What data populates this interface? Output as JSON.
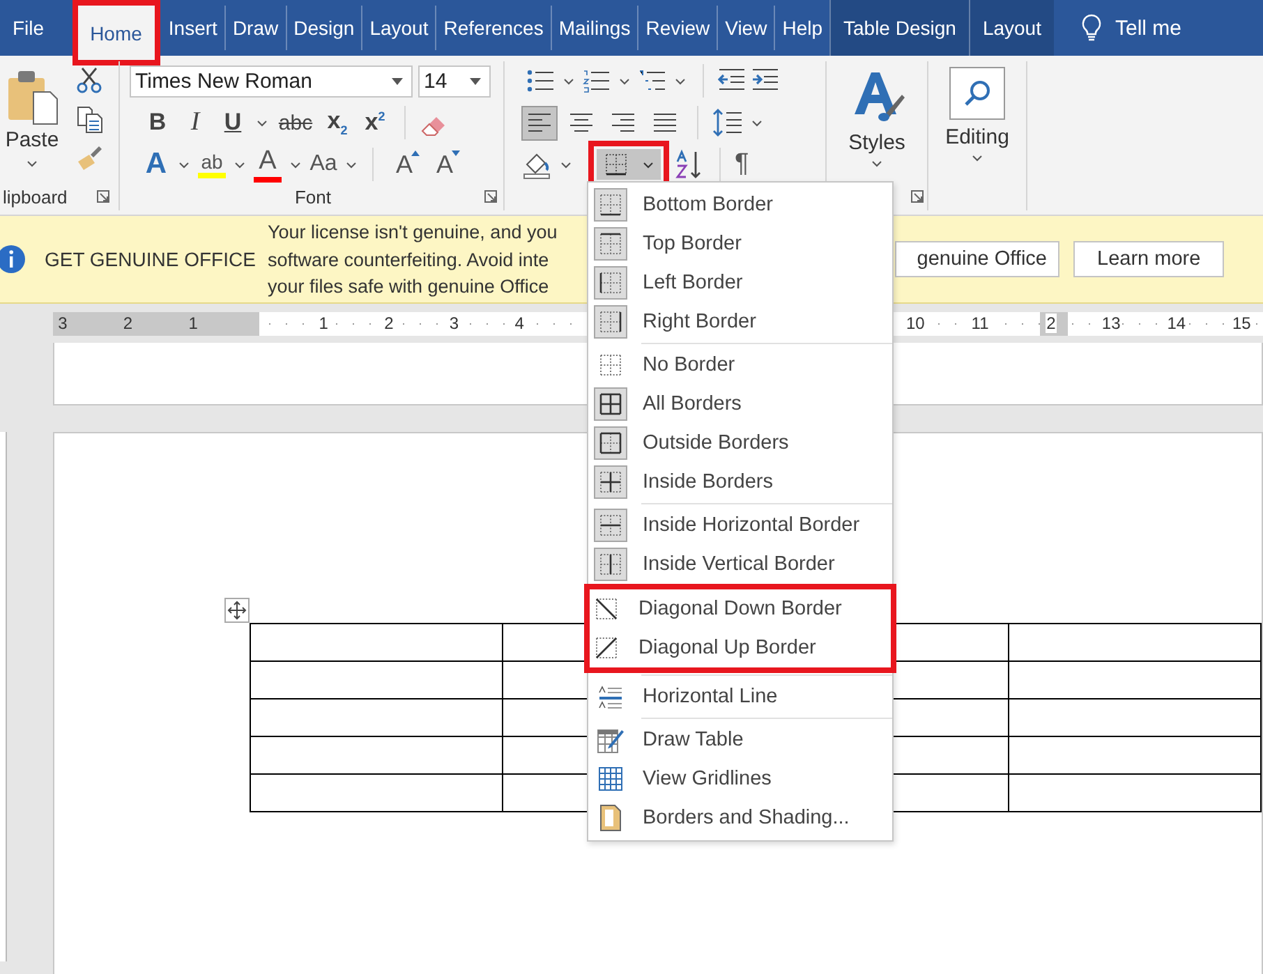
{
  "tabs": [
    {
      "label": "File",
      "selected": false,
      "contextual": false,
      "highlighted": false
    },
    {
      "label": "Home",
      "selected": true,
      "contextual": false,
      "highlighted": true
    },
    {
      "label": "Insert",
      "selected": false,
      "contextual": false,
      "highlighted": false
    },
    {
      "label": "Draw",
      "selected": false,
      "contextual": false,
      "highlighted": false
    },
    {
      "label": "Design",
      "selected": false,
      "contextual": false,
      "highlighted": false
    },
    {
      "label": "Layout",
      "selected": false,
      "contextual": false,
      "highlighted": false
    },
    {
      "label": "References",
      "selected": false,
      "contextual": false,
      "highlighted": false
    },
    {
      "label": "Mailings",
      "selected": false,
      "contextual": false,
      "highlighted": false
    },
    {
      "label": "Review",
      "selected": false,
      "contextual": false,
      "highlighted": false
    },
    {
      "label": "View",
      "selected": false,
      "contextual": false,
      "highlighted": false
    },
    {
      "label": "Help",
      "selected": false,
      "contextual": false,
      "highlighted": false
    },
    {
      "label": "Table Design",
      "selected": false,
      "contextual": true,
      "highlighted": false
    },
    {
      "label": "Layout",
      "selected": false,
      "contextual": true,
      "highlighted": false
    }
  ],
  "tell_me": "Tell me",
  "clipboard": {
    "paste": "Paste",
    "label": "lipboard"
  },
  "font": {
    "name": "Times New Roman",
    "size": "14",
    "label": "Font",
    "format_buttons": [
      {
        "label": "B",
        "kind": "bold",
        "dropdown": false
      },
      {
        "label": "I",
        "kind": "italic",
        "dropdown": false
      },
      {
        "label": "U",
        "kind": "underline",
        "dropdown": true
      },
      {
        "label": "abc",
        "kind": "strike",
        "dropdown": false
      },
      {
        "label": "x$_{2}$",
        "kind": "sub",
        "dropdown": false
      },
      {
        "label": "x$^{2}$",
        "kind": "sup",
        "dropdown": false
      }
    ],
    "effect_buttons": [
      {
        "label": "A",
        "kind": "effects",
        "dropdown": true
      },
      {
        "label": "ab",
        "kind": "highlight",
        "color": "#ffff00",
        "dropdown": true
      },
      {
        "label": "A",
        "kind": "color",
        "color": "#ff0000",
        "dropdown": true
      },
      {
        "label": "Aa",
        "kind": "case",
        "dropdown": true
      }
    ],
    "size_buttons": [
      {
        "label": "A",
        "kind": "grow"
      },
      {
        "label": "A",
        "kind": "shrink"
      }
    ]
  },
  "paragraph": {
    "alignment": [
      {
        "kind": "left",
        "selected": true
      },
      {
        "kind": "center",
        "selected": false
      },
      {
        "kind": "right",
        "selected": false
      },
      {
        "kind": "justify",
        "selected": false
      }
    ],
    "borders_button": {
      "open": true,
      "highlighted": true
    },
    "show_marks": "¶"
  },
  "styles": {
    "label": "Styles"
  },
  "editing": {
    "label": "Editing"
  },
  "message_bar": {
    "title": "GET GENUINE OFFICE",
    "lines": [
      "Your license isn't genuine, and you",
      "software counterfeiting. Avoid inte",
      "your files safe with genuine Office"
    ],
    "buttons": [
      "genuine Office",
      "Learn more"
    ]
  },
  "ruler": [
    "3",
    "2",
    "1",
    "1",
    "2",
    "3",
    "4",
    "10",
    "11",
    "2",
    "13",
    "14",
    "15"
  ],
  "table": {
    "rows": [
      {
        "cells": [
          {
            "kind": "empty"
          },
          {
            "kind": "empty"
          },
          {
            "kind": "empty"
          },
          {
            "kind": "empty"
          }
        ]
      },
      {
        "cells": [
          {
            "kind": "empty"
          },
          {
            "kind": "empty"
          },
          {
            "kind": "empty"
          },
          {
            "kind": "empty"
          }
        ]
      },
      {
        "cells": [
          {
            "kind": "empty"
          },
          {
            "kind": "empty"
          },
          {
            "kind": "empty"
          },
          {
            "kind": "empty"
          }
        ]
      },
      {
        "cells": [
          {
            "kind": "empty"
          },
          {
            "kind": "empty"
          },
          {
            "kind": "empty"
          },
          {
            "kind": "empty"
          }
        ]
      },
      {
        "cells": [
          {
            "kind": "empty"
          },
          {
            "kind": "empty"
          },
          {
            "kind": "empty"
          },
          {
            "kind": "empty"
          }
        ]
      }
    ]
  },
  "border_menu": {
    "sections": [
      {
        "items": [
          {
            "label": "Bottom Border",
            "kind": "bottom",
            "checked": true,
            "highlighted": false
          },
          {
            "label": "Top Border",
            "kind": "top",
            "checked": true,
            "highlighted": false
          },
          {
            "label": "Left Border",
            "kind": "left",
            "checked": true,
            "highlighted": false
          },
          {
            "label": "Right Border",
            "kind": "right",
            "checked": true,
            "highlighted": false
          }
        ]
      },
      {
        "items": [
          {
            "label": "No Border",
            "kind": "none",
            "checked": false,
            "highlighted": false
          },
          {
            "label": "All Borders",
            "kind": "all",
            "checked": true,
            "highlighted": false
          },
          {
            "label": "Outside Borders",
            "kind": "outside",
            "checked": true,
            "highlighted": false
          },
          {
            "label": "Inside Borders",
            "kind": "inside",
            "checked": true,
            "highlighted": false
          }
        ]
      },
      {
        "items": [
          {
            "label": "Inside Horizontal Border",
            "kind": "horizontal",
            "checked": true,
            "highlighted": false
          },
          {
            "label": "Inside Vertical Border",
            "kind": "vertical",
            "checked": true,
            "highlighted": false
          },
          {
            "label": "Diagonal Down Border",
            "kind": "diagdown",
            "checked": false,
            "highlighted": true
          },
          {
            "label": "Diagonal Up Border",
            "kind": "diagup",
            "checked": false,
            "highlighted": true
          }
        ]
      },
      {
        "items": [
          {
            "label": "Horizontal Line",
            "kind": "hline",
            "checked": false,
            "highlighted": false
          }
        ]
      },
      {
        "items": [
          {
            "label": "Draw Table",
            "kind": "draw",
            "checked": false,
            "highlighted": false
          },
          {
            "label": "View Gridlines",
            "kind": "gridlines",
            "checked": false,
            "highlighted": false
          },
          {
            "label": "Borders and Shading...",
            "kind": "shading",
            "checked": false,
            "highlighted": false
          }
        ]
      }
    ]
  }
}
